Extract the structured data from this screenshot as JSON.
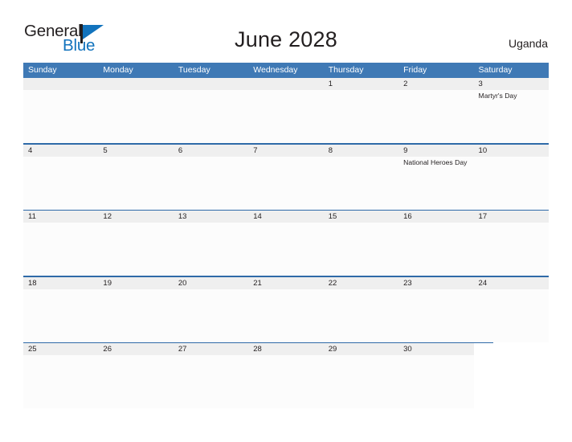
{
  "brand": {
    "name_part1": "General",
    "name_part2": "Blue",
    "flag_icon": "triangle-flag-icon"
  },
  "header": {
    "title": "June 2028",
    "region": "Uganda"
  },
  "calendar": {
    "weekdays": [
      "Sunday",
      "Monday",
      "Tuesday",
      "Wednesday",
      "Thursday",
      "Friday",
      "Saturday"
    ],
    "colors": {
      "header_blue": "#3f79b5",
      "rule_blue": "#2f6aa8",
      "number_band": "#efefef",
      "cell_body": "#fcfcfc",
      "text": "#231f20",
      "brand_blue": "#1273bd"
    },
    "weeks": [
      {
        "days": [
          {
            "num": "",
            "event": "",
            "in_month": false
          },
          {
            "num": "",
            "event": "",
            "in_month": false
          },
          {
            "num": "",
            "event": "",
            "in_month": false
          },
          {
            "num": "",
            "event": "",
            "in_month": false
          },
          {
            "num": "1",
            "event": "",
            "in_month": true
          },
          {
            "num": "2",
            "event": "",
            "in_month": true
          },
          {
            "num": "3",
            "event": "Martyr's Day",
            "in_month": true
          }
        ]
      },
      {
        "days": [
          {
            "num": "4",
            "event": "",
            "in_month": true
          },
          {
            "num": "5",
            "event": "",
            "in_month": true
          },
          {
            "num": "6",
            "event": "",
            "in_month": true
          },
          {
            "num": "7",
            "event": "",
            "in_month": true
          },
          {
            "num": "8",
            "event": "",
            "in_month": true
          },
          {
            "num": "9",
            "event": "National Heroes Day",
            "in_month": true
          },
          {
            "num": "10",
            "event": "",
            "in_month": true
          }
        ]
      },
      {
        "days": [
          {
            "num": "11",
            "event": "",
            "in_month": true
          },
          {
            "num": "12",
            "event": "",
            "in_month": true
          },
          {
            "num": "13",
            "event": "",
            "in_month": true
          },
          {
            "num": "14",
            "event": "",
            "in_month": true
          },
          {
            "num": "15",
            "event": "",
            "in_month": true
          },
          {
            "num": "16",
            "event": "",
            "in_month": true
          },
          {
            "num": "17",
            "event": "",
            "in_month": true
          }
        ]
      },
      {
        "days": [
          {
            "num": "18",
            "event": "",
            "in_month": true
          },
          {
            "num": "19",
            "event": "",
            "in_month": true
          },
          {
            "num": "20",
            "event": "",
            "in_month": true
          },
          {
            "num": "21",
            "event": "",
            "in_month": true
          },
          {
            "num": "22",
            "event": "",
            "in_month": true
          },
          {
            "num": "23",
            "event": "",
            "in_month": true
          },
          {
            "num": "24",
            "event": "",
            "in_month": true
          }
        ]
      },
      {
        "days": [
          {
            "num": "25",
            "event": "",
            "in_month": true
          },
          {
            "num": "26",
            "event": "",
            "in_month": true
          },
          {
            "num": "27",
            "event": "",
            "in_month": true
          },
          {
            "num": "28",
            "event": "",
            "in_month": true
          },
          {
            "num": "29",
            "event": "",
            "in_month": true
          },
          {
            "num": "30",
            "event": "",
            "in_month": true
          },
          {
            "num": "",
            "event": "",
            "in_month": false
          }
        ]
      }
    ]
  }
}
